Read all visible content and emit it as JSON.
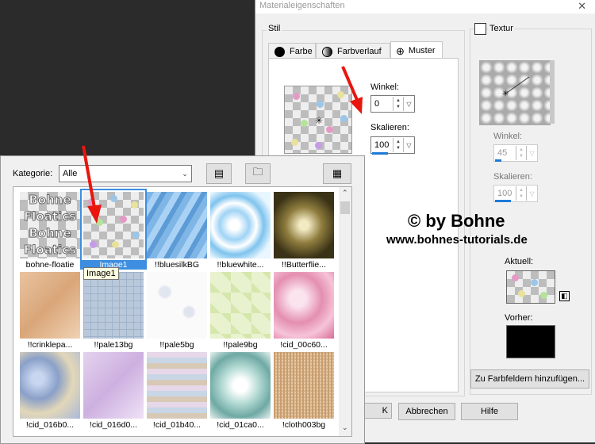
{
  "material_dialog": {
    "title": "Materialeigenschaften",
    "close_glyph": "✕",
    "stil_label": "Stil",
    "tabs": [
      {
        "label": "Farbe"
      },
      {
        "label": "Farbverlauf"
      },
      {
        "label": "Muster"
      }
    ],
    "winkel_label": "Winkel:",
    "winkel_value": "0",
    "skalieren_label": "Skalieren:",
    "skalieren_value": "100",
    "texture": {
      "label": "Textur",
      "winkel_label": "Winkel:",
      "winkel_value": "45",
      "skalieren_label": "Skalieren:",
      "skalieren_value": "100"
    },
    "aktuell_label": "Aktuell:",
    "vorher_label": "Vorher:",
    "add_swatch_button": "Zu Farbfeldern hinzufügen...",
    "ok_button": "K",
    "cancel_button": "Abbrechen",
    "help_button": "Hilfe"
  },
  "watermark": {
    "line1": "© by Bohne",
    "line2": "www.bohnes-tutorials.de"
  },
  "pattern_browser": {
    "category_label": "Kategorie:",
    "category_value": "Alle",
    "tooltip": "Image1",
    "items": [
      {
        "name": "bohne-floatie"
      },
      {
        "name": "Image1",
        "selected": true
      },
      {
        "name": "!!bluesilkBG"
      },
      {
        "name": "!!bluewhite..."
      },
      {
        "name": "!!Butterflie..."
      },
      {
        "name": "!!crinklepa..."
      },
      {
        "name": "!!pale13bg"
      },
      {
        "name": "!!pale5bg"
      },
      {
        "name": "!!pale9bg"
      },
      {
        "name": "!cid_00c60..."
      },
      {
        "name": "!cid_016b0..."
      },
      {
        "name": "!cid_016d0..."
      },
      {
        "name": "!cid_01b40..."
      },
      {
        "name": "!cid_01ca0..."
      },
      {
        "name": "!cloth003bg"
      }
    ],
    "thumb_logo_text": [
      "Bohne",
      "Floatics",
      "Bohne",
      "Floatics"
    ]
  },
  "colors": {
    "selection": "#3d8ee0",
    "arrow": "#e8160f",
    "background": "#2b2b2b"
  }
}
